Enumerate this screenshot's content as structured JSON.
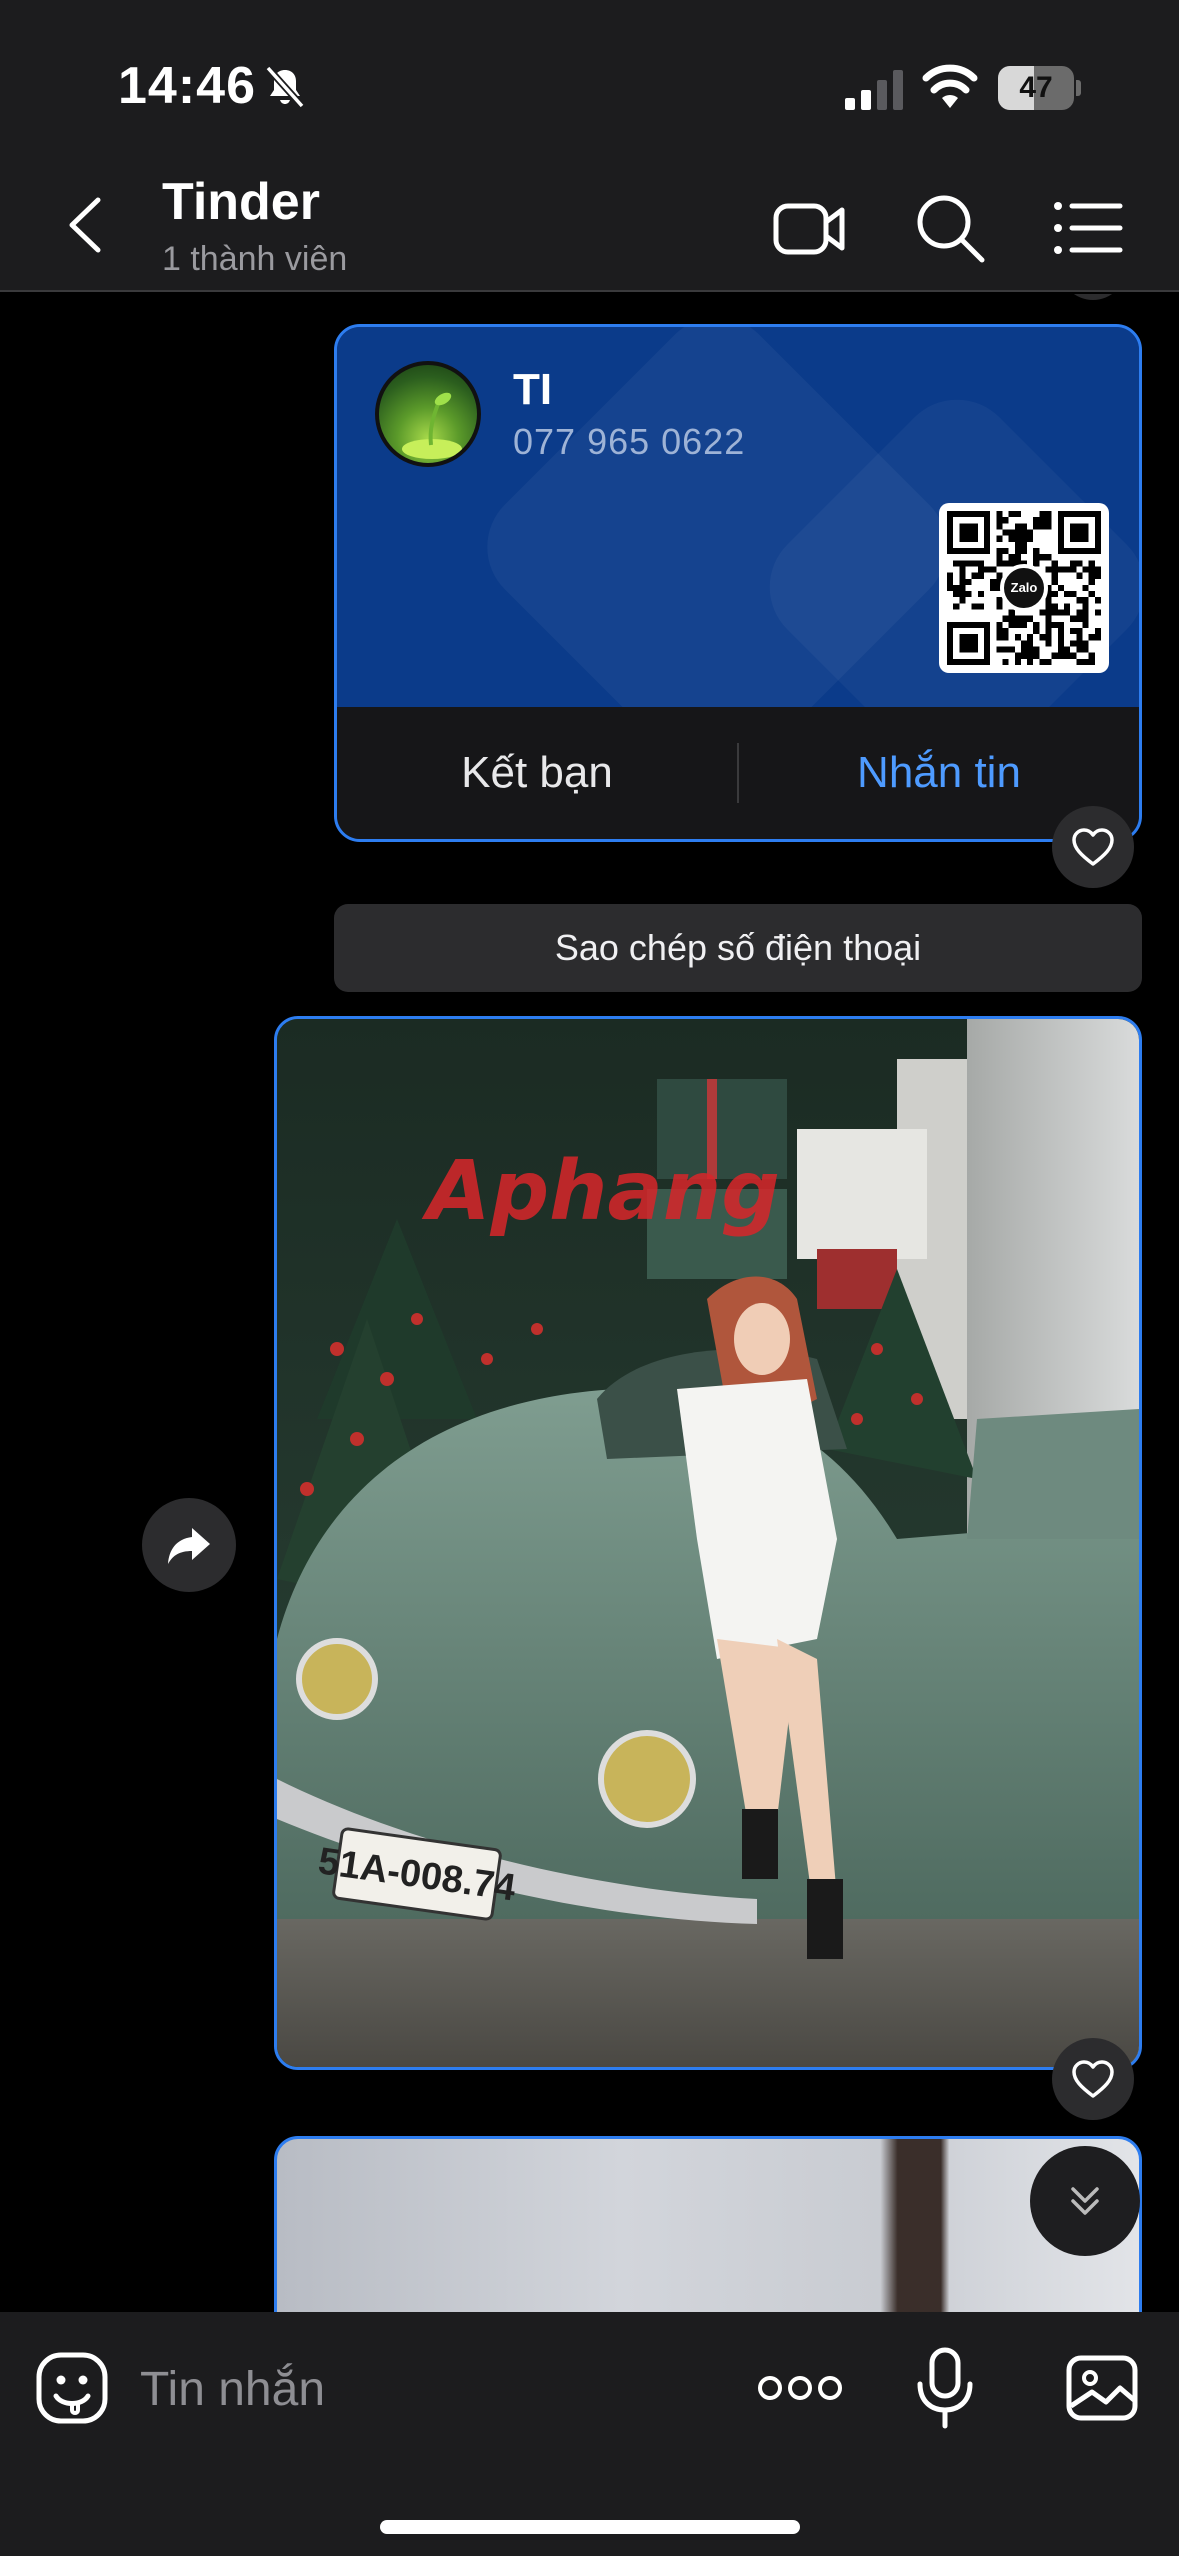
{
  "status_bar": {
    "time": "14:46",
    "battery_level": "47",
    "battery_fraction": 0.47,
    "icons": [
      "bell-slash-icon",
      "cellular-signal-icon",
      "wifi-icon",
      "battery-icon"
    ]
  },
  "header": {
    "title": "Tinder",
    "subtitle": "1 thành viên",
    "icons": [
      "back-chevron-icon",
      "video-call-icon",
      "search-icon",
      "menu-list-icon"
    ]
  },
  "contact_card": {
    "name": "TI",
    "phone": "077 965 0622",
    "qr_logo_text": "Zalo",
    "add_friend_label": "Kết bạn",
    "message_label": "Nhắn tin",
    "accent_color": "#2d7df0",
    "card_color": "#0b3b8a",
    "message_color": "#4e9bff"
  },
  "copy_phone_label": "Sao chép số điện thoại",
  "photo": {
    "watermark_text": "Aphang",
    "license_plate_text": "51A-008.74"
  },
  "input_bar": {
    "placeholder": "Tin nhắn",
    "icons": [
      "sticker-icon",
      "more-dots-icon",
      "microphone-icon",
      "gallery-icon"
    ]
  }
}
